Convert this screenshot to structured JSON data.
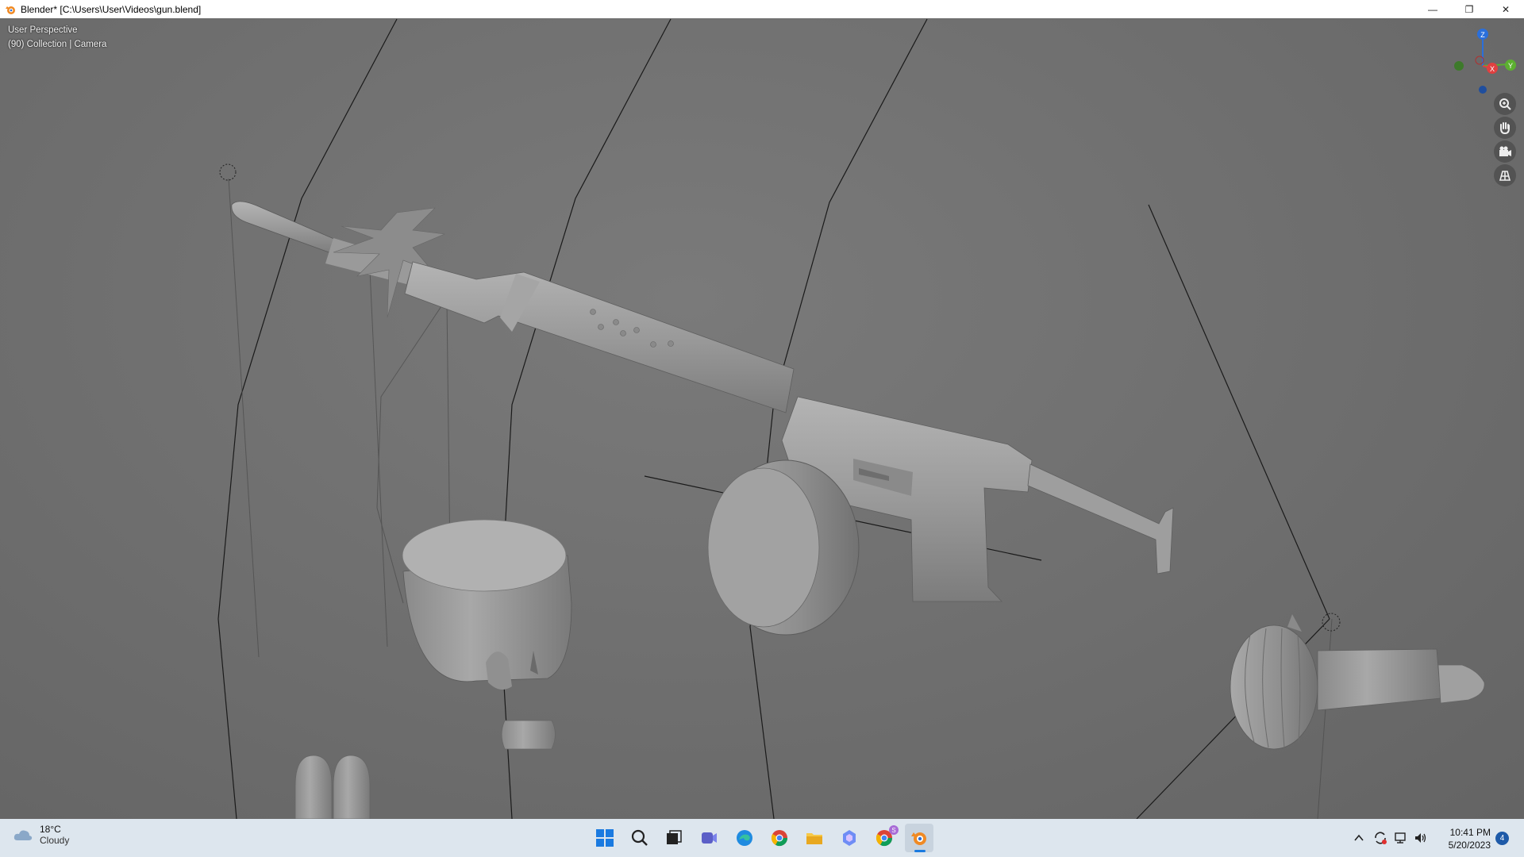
{
  "window": {
    "title": "Blender* [C:\\Users\\User\\Videos\\gun.blend]",
    "controls": {
      "minimize": "—",
      "maximize": "❐",
      "close": "✕"
    }
  },
  "viewport": {
    "mode_text": "User Perspective",
    "context_text": "(90) Collection | Camera",
    "gizmo_axes": {
      "z": "Z",
      "x": "X",
      "y": "Y"
    },
    "nav_buttons": [
      "zoom-icon",
      "pan-hand-icon",
      "camera-icon",
      "grid-ortho-icon"
    ]
  },
  "taskbar": {
    "weather": {
      "temp": "18°C",
      "condition": "Cloudy"
    },
    "apps": [
      "windows-start-icon",
      "search-icon",
      "task-view-icon",
      "teams-icon",
      "edge-icon",
      "chrome-icon",
      "file-explorer-icon",
      "copilot-icon",
      "chrome-profile-icon",
      "blender-icon"
    ],
    "chrome_profile_badge": "S",
    "clock": {
      "time": "10:41 PM",
      "date": "5/20/2023"
    },
    "notification_count": "4"
  },
  "colors": {
    "viewport_bg": "#6b6b6b",
    "gizmo_z": "#2a6fdb",
    "gizmo_x": "#e04040",
    "gizmo_y": "#5cb030",
    "taskbar_bg": "#dde6ee"
  }
}
